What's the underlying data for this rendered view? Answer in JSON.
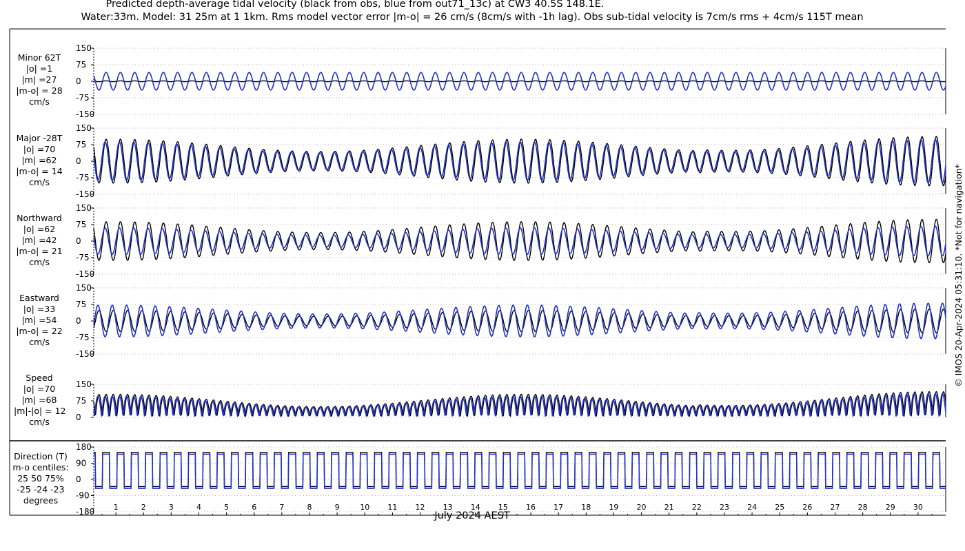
{
  "title_line1": "Predicted depth-average tidal velocity (black from obs, blue from out71_13c) at CW3 40.5S 148.1E.",
  "title_line2": "Water:33m. Model: 31 25m at 1 1km. Rms model vector error |m-o| = 26 cm/s (8cm/s with -1h lag). Obs sub-tidal velocity is 7cm/s rms + 4cm/s 115T mean",
  "xlabel": "July 2024 AEST",
  "copyright": "© IMOS 20-Apr-2024 05:31:10. *Not for navigation*",
  "colors": {
    "obs": "#000000",
    "model": "#1f2fd0",
    "grid": "#9a9a9a",
    "axis": "#000000"
  },
  "panels": [
    {
      "id": "minor",
      "label": [
        "Minor 62T",
        "|o| =1",
        "|m| =27",
        "|m-o| = 28",
        "cm/s"
      ]
    },
    {
      "id": "major",
      "label": [
        "Major -28T",
        "|o| =70",
        "|m| =62",
        "|m-o| = 14",
        "cm/s"
      ]
    },
    {
      "id": "north",
      "label": [
        "Northward",
        "|o| =62",
        "|m| =42",
        "|m-o| = 21",
        "cm/s"
      ]
    },
    {
      "id": "east",
      "label": [
        "Eastward",
        "|o| =33",
        "|m| =54",
        "|m-o| = 22",
        "cm/s"
      ]
    },
    {
      "id": "speed",
      "label": [
        "Speed",
        "|o| =70",
        "|m| =68",
        "|m|-|o| = 12",
        "cm/s"
      ]
    },
    {
      "id": "direction",
      "label": [
        "Direction (T)",
        "m-o centiles:",
        "25  50  75%",
        "-25 -24 -23",
        "degrees"
      ]
    }
  ],
  "chart_data": {
    "type": "line",
    "x_unit": "day of July 2024 (AEST)",
    "xlim": [
      0.2,
      31
    ],
    "x_ticks": [
      1,
      2,
      3,
      4,
      5,
      6,
      7,
      8,
      9,
      10,
      11,
      12,
      13,
      14,
      15,
      16,
      17,
      18,
      19,
      20,
      21,
      22,
      23,
      24,
      25,
      26,
      27,
      28,
      29,
      30
    ],
    "tide_period_hours": 12.42,
    "subplots": [
      {
        "name": "minor",
        "ylabel": "Minor 62T",
        "ylim": [
          -150,
          150
        ],
        "yticks": [
          -150,
          -75,
          0,
          75,
          150
        ],
        "series": [
          {
            "name": "obs",
            "kind": "tidal",
            "amplitude": 2,
            "mean": 0,
            "phase_deg": 0
          },
          {
            "name": "model",
            "kind": "tidal",
            "amplitude": 40,
            "mean": 0,
            "phase_deg": 0
          }
        ]
      },
      {
        "name": "major",
        "ylabel": "Major -28T",
        "ylim": [
          -150,
          150
        ],
        "yticks": [
          -150,
          -75,
          0,
          75,
          150
        ],
        "series": [
          {
            "name": "obs",
            "kind": "tidal",
            "amplitude": 100,
            "mean": 0,
            "phase_deg": 0,
            "envelope": "springneap"
          },
          {
            "name": "model",
            "kind": "tidal",
            "amplitude": 88,
            "mean": 0,
            "phase_deg": 25,
            "envelope": "springneap"
          }
        ]
      },
      {
        "name": "north",
        "ylabel": "Northward",
        "ylim": [
          -150,
          150
        ],
        "yticks": [
          -150,
          -75,
          0,
          75,
          150
        ],
        "series": [
          {
            "name": "obs",
            "kind": "tidal",
            "amplitude": 88,
            "mean": 0,
            "phase_deg": 0,
            "envelope": "springneap"
          },
          {
            "name": "model",
            "kind": "tidal",
            "amplitude": 60,
            "mean": 0,
            "phase_deg": 25,
            "envelope": "springneap"
          }
        ]
      },
      {
        "name": "east",
        "ylabel": "Eastward",
        "ylim": [
          -150,
          150
        ],
        "yticks": [
          -150,
          -75,
          0,
          75,
          150
        ],
        "series": [
          {
            "name": "obs",
            "kind": "tidal",
            "amplitude": 48,
            "mean": 0,
            "phase_deg": 180,
            "envelope": "springneap"
          },
          {
            "name": "model",
            "kind": "tidal",
            "amplitude": 72,
            "mean": 0,
            "phase_deg": 205,
            "envelope": "springneap"
          }
        ]
      },
      {
        "name": "speed",
        "ylabel": "Speed",
        "ylim": [
          0,
          150
        ],
        "yticks": [
          0,
          75,
          150
        ],
        "series": [
          {
            "name": "obs",
            "kind": "speed",
            "amplitude": 100,
            "mean": 0,
            "phase_deg": 0,
            "envelope": "springneap"
          },
          {
            "name": "model",
            "kind": "speed",
            "amplitude": 92,
            "mean": 0,
            "phase_deg": 25,
            "envelope": "springneap"
          }
        ]
      },
      {
        "name": "direction",
        "ylabel": "Direction (T)",
        "ylim": [
          -180,
          180
        ],
        "yticks": [
          -180,
          -90,
          0,
          90,
          180
        ],
        "series": [
          {
            "name": "obs",
            "kind": "direction",
            "values_deg": [
              150,
              -40
            ]
          },
          {
            "name": "model",
            "kind": "direction",
            "values_deg": [
              140,
              -50
            ]
          }
        ]
      }
    ]
  }
}
